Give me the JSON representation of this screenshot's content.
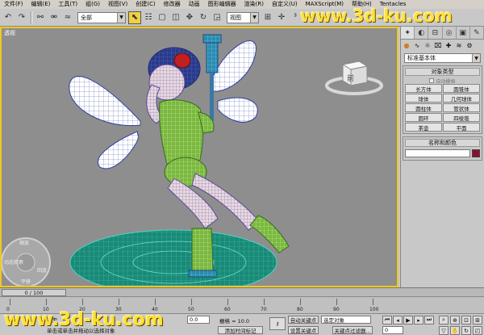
{
  "menubar": {
    "items": [
      "文件(F)",
      "编辑(E)",
      "工具(T)",
      "组(G)",
      "视图(V)",
      "创建(C)",
      "修改器",
      "动画",
      "图形编辑器",
      "渲染(R)",
      "自定义(U)",
      "MAXScript(M)",
      "帮助(H)",
      "Tentacles"
    ]
  },
  "toolbar": {
    "selection_filter": "全部",
    "reference_coord": "视图",
    "icons": [
      "undo-icon",
      "redo-icon",
      "link-icon",
      "unlink-icon",
      "bind-icon",
      "select-icon",
      "select-by-name-icon",
      "rect-region-icon",
      "window-crossing-icon",
      "move-icon",
      "rotate-icon",
      "scale-icon",
      "pivot-icon",
      "manipulate-icon",
      "snap-icon",
      "angle-snap-icon",
      "percent-snap-icon",
      "spinner-snap-icon",
      "named-selection-icon",
      "mirror-icon",
      "align-icon"
    ]
  },
  "viewport": {
    "label": "透视",
    "viewcube_face": "前",
    "steering_wheel": [
      "缩放",
      "动态观察",
      "平移",
      "回放"
    ]
  },
  "command_panel": {
    "dropdown": "标准基本体",
    "object_type_title": "对象类型",
    "autogrid_label": "自动栅格",
    "objects": [
      "长方体",
      "圆锥体",
      "球体",
      "几何球体",
      "圆柱体",
      "管状体",
      "圆环",
      "四棱锥",
      "茶壶",
      "平面"
    ],
    "name_color_title": "名称和颜色",
    "accent_color": "#8a1030"
  },
  "timeline": {
    "frame_display": "0 / 100",
    "ticks": [
      "0",
      "10",
      "20",
      "30",
      "40",
      "50",
      "60",
      "70",
      "80",
      "90",
      "100"
    ]
  },
  "statusbar": {
    "selection_text": "选定",
    "prompt_text": "单击或单击并拖动以选择对象",
    "grid_label": "栅格 = 10.0",
    "z_value": "0.0",
    "add_time_tag": "添加时间标记",
    "auto_key": "自动关键点",
    "set_key": "设置关键点",
    "selected_objects": "选定对象",
    "key_filters": "关键点过滤器...",
    "frame_field": "0"
  },
  "watermarks": {
    "top": "www.3d-ku.com",
    "bottom": "www.3d-ku.com"
  }
}
